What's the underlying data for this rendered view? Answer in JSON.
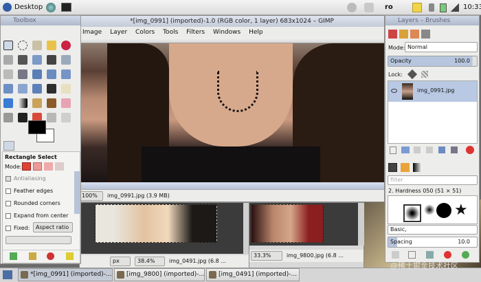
{
  "top_panel": {
    "desktop_label": "Desktop",
    "indicator_ro": "ro",
    "clock": "10:33"
  },
  "gimp_window": {
    "title": "*[img_0991] (imported)-1.0 (RGB color, 1 layer) 683x1024 – GIMP",
    "menu": [
      "Image",
      "Layer",
      "Colors",
      "Tools",
      "Filters",
      "Windows",
      "Help"
    ],
    "status_zoom": "100%",
    "status_file": "img_0991.jpg (3.9 MB)"
  },
  "toolbox": {
    "title": "Toolbox",
    "tool_options_title": "Rectangle Select",
    "mode_label": "Mode:",
    "options": [
      "Antialiasing",
      "Feather edges",
      "Rounded corners",
      "Expand from center"
    ],
    "fixed_label": "Fixed:",
    "fixed_value": "Aspect ratio"
  },
  "layers_dock": {
    "title": "Layers – Brushes",
    "mode_label": "Mode:",
    "mode_value": "Normal",
    "opacity_label": "Opacity",
    "opacity_value": "100.0",
    "lock_label": "Lock:",
    "layer_name": "img_0991.jpg",
    "filter_placeholder": "filter",
    "brush_label": "2. Hardness 050 (51 × 51)",
    "brush_preset": "Basic,",
    "spacing_label": "Spacing",
    "spacing_value": "10.0"
  },
  "win_0491": {
    "unit": "px",
    "zoom": "38.4%",
    "status": "img_0491.jpg (6.8 ..."
  },
  "win_9800": {
    "zoom": "33.3%",
    "status": "img_9800.jpg (6.8 ..."
  },
  "taskbar": [
    "*[img_0991] (imported)-...",
    "[img_9800] (imported)-...",
    "[img_0491] (imported)-..."
  ],
  "watermark": "@稀土掘金技术社区"
}
